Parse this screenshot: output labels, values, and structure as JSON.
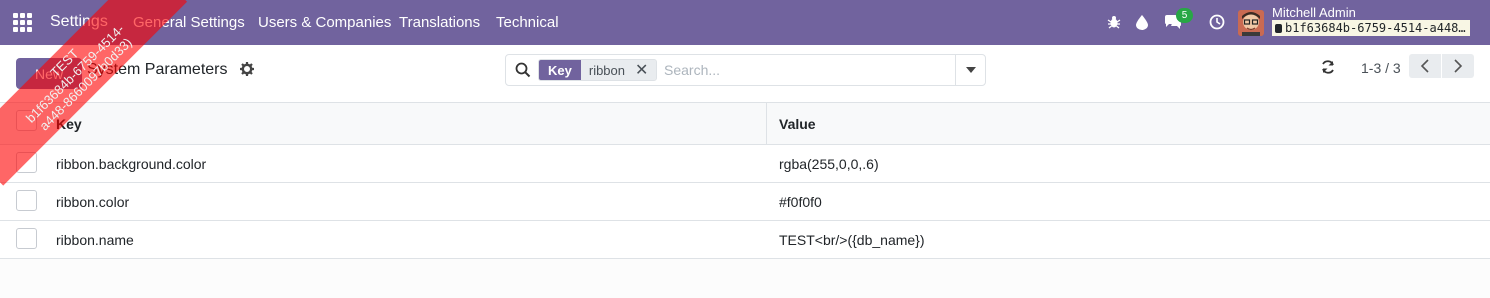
{
  "navbar": {
    "brand": "Settings",
    "menu": [
      "General Settings",
      "Users & Companies",
      "Translations",
      "Technical"
    ],
    "chat_count": "5",
    "user_name": "Mitchell Admin",
    "db_name": "b1f63684b-6759-4514-a448…"
  },
  "ribbon": {
    "line1": "TEST",
    "line2": "b1f63684b-6759-4514-",
    "line3": "a448-8660097b0d33)"
  },
  "control_panel": {
    "new_label": "New",
    "title": "System Parameters",
    "search": {
      "facet_key": "Key",
      "facet_value": "ribbon",
      "placeholder": "Search..."
    },
    "pager": "1-3 / 3"
  },
  "table": {
    "columns": [
      "Key",
      "Value"
    ],
    "rows": [
      {
        "key": "ribbon.background.color",
        "value": "rgba(255,0,0,.6)"
      },
      {
        "key": "ribbon.color",
        "value": "#f0f0f0"
      },
      {
        "key": "ribbon.name",
        "value": "TEST<br/>({db_name})"
      }
    ]
  },
  "colors": {
    "navbar": "#71639e",
    "ribbon_background": "rgba(255,0,0,.6)",
    "ribbon_text": "#f0f0f0",
    "badge": "#28a745"
  },
  "icons": [
    "apps-grid-icon",
    "bug-icon",
    "drop-icon",
    "chat-icon",
    "clock-icon",
    "database-icon",
    "search-icon",
    "gear-icon",
    "reload-icon",
    "chevron-left-icon",
    "chevron-right-icon",
    "caret-down-icon"
  ]
}
